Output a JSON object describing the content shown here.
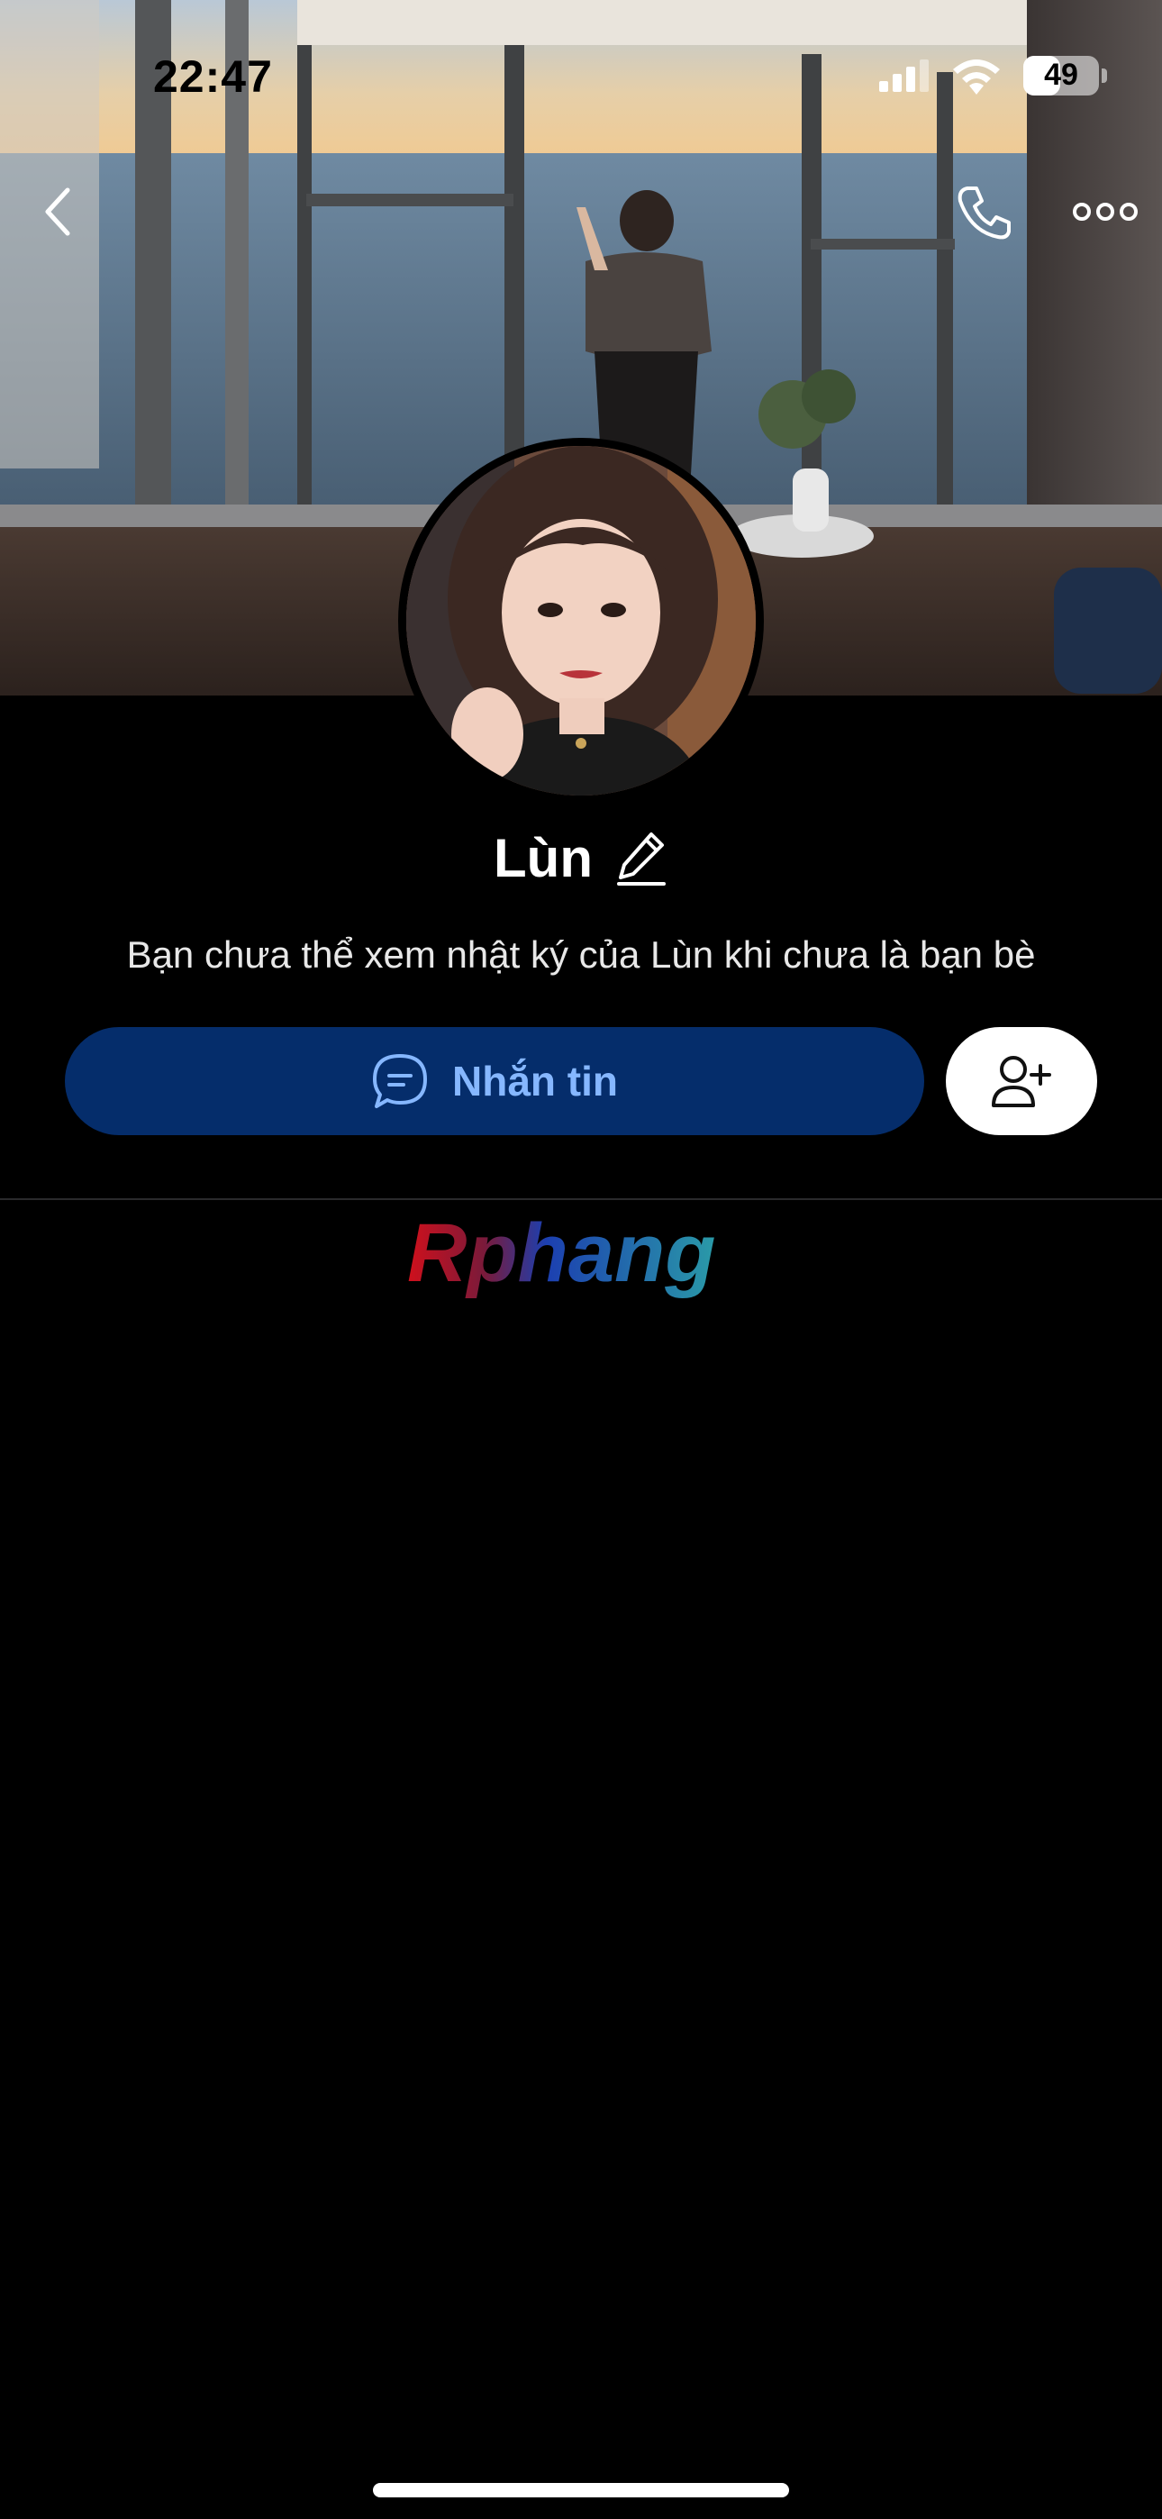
{
  "status_bar": {
    "time": "22:47",
    "battery_level": "49",
    "battery_fraction": 0.49,
    "icons": [
      "cellular-signal-icon",
      "wifi-icon",
      "battery-icon"
    ]
  },
  "nav": {
    "back_icon": "chevron-left-icon",
    "call_icon": "phone-icon",
    "more_icon": "more-horizontal-icon"
  },
  "profile": {
    "name": "Lùn",
    "edit_icon": "pencil-icon",
    "notice": "Bạn chưa thể xem nhật ký của Lùn khi chưa là bạn bè"
  },
  "actions": {
    "message_label": "Nhắn tin",
    "message_icon": "chat-bubble-icon",
    "add_friend_icon": "add-user-icon"
  },
  "watermark": {
    "text": "Rphang"
  },
  "colors": {
    "background": "#000000",
    "message_button_bg": "#052d6b",
    "message_button_text": "#86b7ff",
    "add_friend_bg": "#ffffff"
  }
}
